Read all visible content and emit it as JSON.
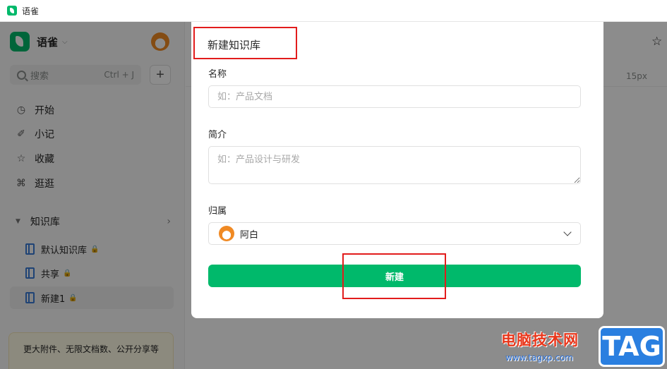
{
  "window": {
    "title": "语雀"
  },
  "sidebar": {
    "brand_name": "语雀",
    "search": {
      "placeholder": "搜索",
      "shortcut": "Ctrl + J"
    },
    "add_label": "+",
    "nav_items": [
      {
        "label": "开始",
        "icon": "clock-icon"
      },
      {
        "label": "小记",
        "icon": "feather-icon"
      },
      {
        "label": "收藏",
        "icon": "star-icon"
      },
      {
        "label": "逛逛",
        "icon": "grid-icon"
      }
    ],
    "section_title": "知识库",
    "books": [
      {
        "label": "默认知识库",
        "locked": true
      },
      {
        "label": "共享",
        "locked": true
      },
      {
        "label": "新建1",
        "locked": true,
        "active": true
      }
    ],
    "promo_text": "更大附件、无限文档数、公开分享等"
  },
  "main": {
    "toolbar_font_size": "15px"
  },
  "modal": {
    "title": "新建知识库",
    "name_label": "名称",
    "name_placeholder": "如：产品文档",
    "intro_label": "简介",
    "intro_placeholder": "如：产品设计与研发",
    "owner_label": "归属",
    "owner_value": "阿白",
    "create_label": "新建"
  },
  "watermark": {
    "text": "电脑技术网",
    "url": "www.tagxp.com",
    "tag": "TAG"
  },
  "colors": {
    "accent": "#00b96b",
    "highlight": "#e21c1c"
  }
}
